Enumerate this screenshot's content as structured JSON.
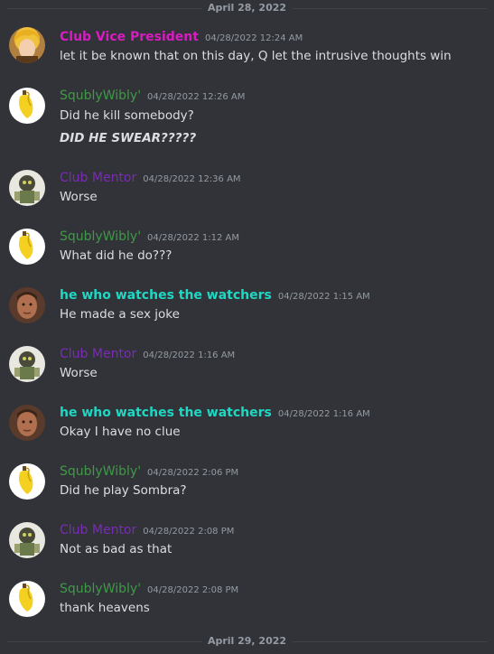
{
  "dividers": [
    "April 28, 2022",
    "April 29, 2022"
  ],
  "users": {
    "vp": {
      "name": "Club Vice President",
      "color": "#d81cc1",
      "avatar": "blonde-character-avatar"
    },
    "sqw": {
      "name": "SqublyWibly'",
      "color": "#3f9a47",
      "avatar": "banana-avatar"
    },
    "mentor": {
      "name": "Club Mentor",
      "color": "#7b2bb8",
      "avatar": "robot-character-avatar"
    },
    "watcher": {
      "name": "he who watches the watchers",
      "color": "#1fd8c4",
      "avatar": "face-avatar"
    }
  },
  "messages": [
    {
      "user": "vp",
      "time": "04/28/2022 12:24 AM",
      "lines": [
        "let it be known that on this day, Q let the intrusive thoughts win"
      ]
    },
    {
      "user": "sqw",
      "time": "04/28/2022 12:26 AM",
      "lines": [
        "Did he kill somebody?",
        "DID HE SWEAR?????"
      ]
    },
    {
      "user": "mentor",
      "time": "04/28/2022 12:36 AM",
      "lines": [
        "Worse"
      ]
    },
    {
      "user": "sqw",
      "time": "04/28/2022 1:12 AM",
      "lines": [
        "What did he do???"
      ]
    },
    {
      "user": "watcher",
      "time": "04/28/2022 1:15 AM",
      "lines": [
        "He made a sex joke"
      ]
    },
    {
      "user": "mentor",
      "time": "04/28/2022 1:16 AM",
      "lines": [
        "Worse"
      ]
    },
    {
      "user": "watcher",
      "time": "04/28/2022 1:16 AM",
      "lines": [
        "Okay I have no clue"
      ]
    },
    {
      "user": "sqw",
      "time": "04/28/2022 2:06 PM",
      "lines": [
        "Did he play Sombra?"
      ]
    },
    {
      "user": "mentor",
      "time": "04/28/2022 2:08 PM",
      "lines": [
        "Not as bad as that"
      ]
    },
    {
      "user": "sqw",
      "time": "04/28/2022 2:08 PM",
      "lines": [
        "thank heavens"
      ]
    }
  ]
}
